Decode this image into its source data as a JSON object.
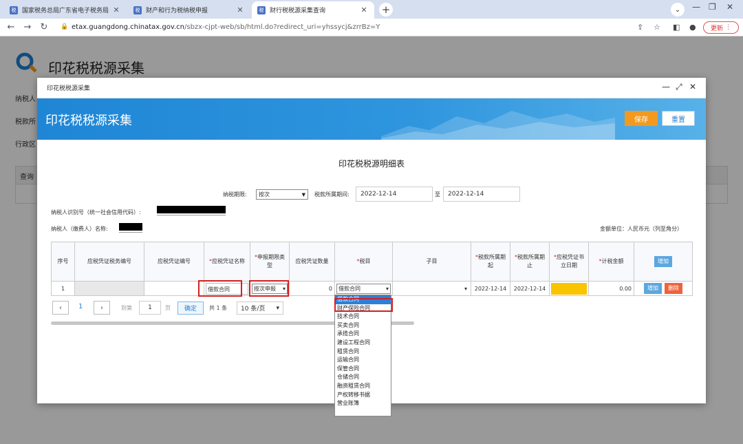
{
  "browser": {
    "tabs": [
      {
        "fav": "税",
        "label": "国家税务总局广东省电子税务局",
        "active": false
      },
      {
        "fav": "税",
        "label": "财产和行为税纳税申报",
        "active": false
      },
      {
        "fav": "税",
        "label": "财行税税源采集查询",
        "active": true
      }
    ],
    "url_host": "etax.guangdong.chinatax.gov.cn",
    "url_path": "/sbzx-cjpt-web/sb/html.do?redirect_uri=yhssycj&zrrBz=Y",
    "update_label": "更新"
  },
  "page": {
    "title": "印花税税源采集",
    "labels": [
      "纳税人",
      "税款所",
      "行政区"
    ],
    "query_head": "查询"
  },
  "modal": {
    "title": "印花税税源采集",
    "banner_title": "印花税税源采集",
    "save_label": "保存",
    "reset_label": "重置",
    "form_title": "印花税税源明细表",
    "period_label": "纳税期限:",
    "period_value": "按次",
    "belong_label": "税款所属期间:",
    "date_start": "2022-12-14",
    "date_to": "至",
    "date_end": "2022-12-14",
    "taxpayer_id_label": "纳税人识别号（统一社会信用代码）:",
    "taxpayer_name_label": "纳税人（缴费人）名称:",
    "amount_unit": "金额单位：人民币元（列至角分）",
    "table": {
      "headers": [
        {
          "text": "序号",
          "req": false
        },
        {
          "text": "应税凭证税务编号",
          "req": false
        },
        {
          "text": "应税凭证编号",
          "req": false
        },
        {
          "text": "应税凭证名称",
          "req": true
        },
        {
          "text": "申报期限类型",
          "req": true
        },
        {
          "text": "应税凭证数量",
          "req": false
        },
        {
          "text": "税目",
          "req": true
        },
        {
          "text": "子目",
          "req": false
        },
        {
          "text": "税款所属期起",
          "req": true
        },
        {
          "text": "税款所属期止",
          "req": true
        },
        {
          "text": "应税凭证书立日期",
          "req": true
        },
        {
          "text": "计税金额",
          "req": true
        }
      ],
      "add_header_label": "增加",
      "row": {
        "index": "1",
        "voucher_name": "借款合同",
        "period_type": "按次申报",
        "quantity": "0",
        "tax_item": "借款合同",
        "start": "2022-12-14",
        "end": "2022-12-14",
        "amount": "0.00",
        "add_label": "增加",
        "delete_label": "删除"
      }
    },
    "pagination": {
      "page": "1",
      "goto_label": "到第",
      "goto_value": "1",
      "page_unit": "页",
      "confirm_label": "确定",
      "total": "共 1 条",
      "page_size": "10 条/页"
    },
    "dropdown_items": [
      "借款合同",
      "财产保险合同",
      "技术合同",
      "买卖合同",
      "承揽合同",
      "建设工程合同",
      "租赁合同",
      "运输合同",
      "保管合同",
      "仓储合同",
      "融资租赁合同",
      "产权转移书据",
      "营业账簿"
    ],
    "dropdown_selected_index": 0
  }
}
